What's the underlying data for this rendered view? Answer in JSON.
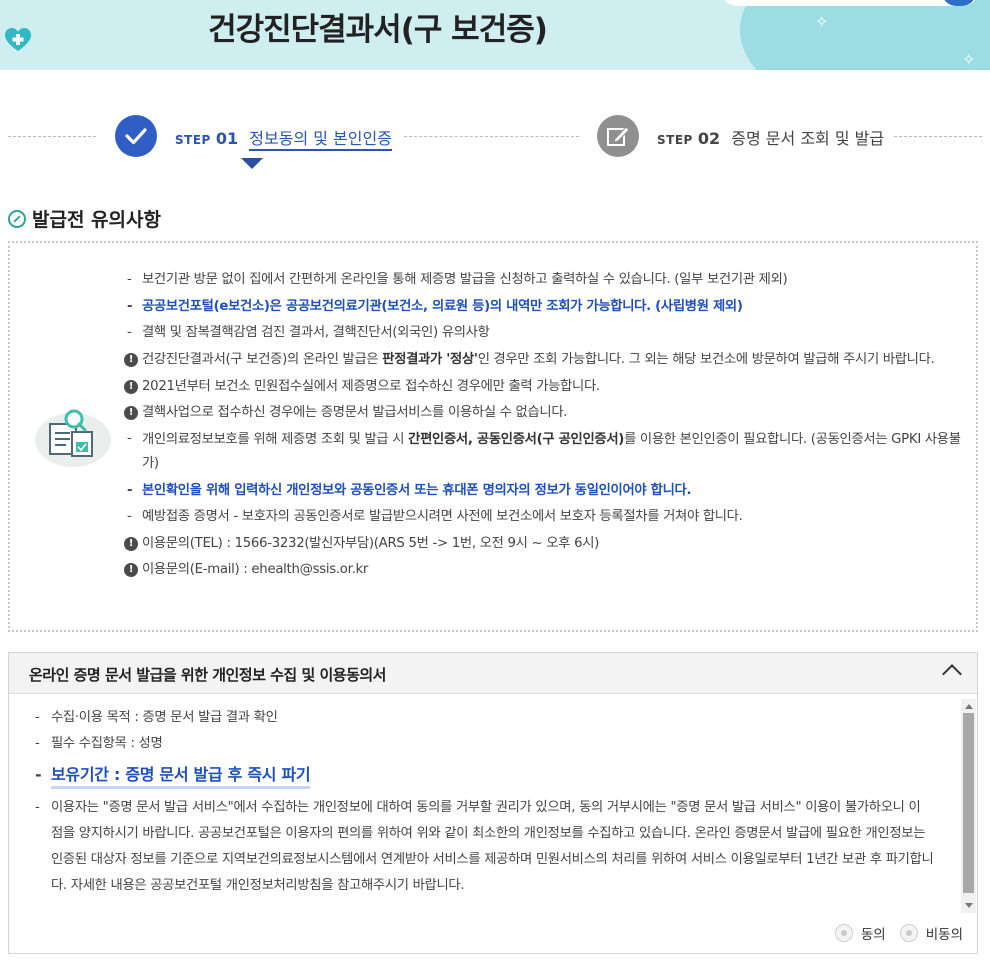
{
  "header": {
    "title": "건강진단결과서(구 보건증)"
  },
  "steps": [
    {
      "word": "STEP",
      "number": "01",
      "label": "정보동의 및 본인인증"
    },
    {
      "word": "STEP",
      "number": "02",
      "label": "증명 문서 조회 및 발급"
    }
  ],
  "notice": {
    "title": "발급전 유의사항",
    "items": {
      "i0": "보건기관 방문 없이 집에서 간편하게 온라인을 통해 제증명 발급을 신청하고 출력하실 수 있습니다. (일부 보건기관 제외)",
      "i1": "공공보건포털(e보건소)은 공공보건의료기관(보건소, 의료원 등)의 내역만 조회가 가능합니다. (사립병원 제외)",
      "i2": "결핵 및 잠복결핵감염 검진 결과서, 결핵진단서(외국인) 유의사항",
      "i3a": "건강진단결과서(구 보건증)의 온라인 발급은 ",
      "i3b": "판정결과가 '정상'",
      "i3c": "인 경우만 조회 가능합니다. 그 외는 해당 보건소에 방문하여 발급해 주시기 바랍니다.",
      "i4": "2021년부터 보건소 민원접수실에서 제증명으로 접수하신 경우에만 출력 가능합니다.",
      "i5": "결핵사업으로 접수하신 경우에는 증명문서 발급서비스를 이용하실 수 없습니다.",
      "i6a": "개인의료정보보호를 위해 제증명 조회 및 발급 시 ",
      "i6b": "간편인증서, 공동인증서(구 공인인증서)",
      "i6c": "를 이용한 본인인증이 필요합니다. (공동인증서는 GPKI 사용불가)",
      "i7": "본인확인을 위해 입력하신 개인정보와 공동인증서 또는 휴대폰 명의자의 정보가 동일인이어야 합니다.",
      "i8": "예방접종 증명서 - 보호자의 공동인증서로 발급받으시려면 사전에 보건소에서 보호자 등록절차를 거쳐야 합니다.",
      "i9": "이용문의(TEL) : 1566-3232(발신자부담)(ARS 5번 -> 1번, 오전 9시 ~ 오후 6시)",
      "i10": "이용문의(E-mail) : ehealth@ssis.or.kr"
    }
  },
  "agreement": {
    "title": "온라인 증명 문서 발급을 위한 개인정보 수집 및 이용동의서",
    "items": {
      "purpose": "수집·이용 목적 : 증명 문서 발급 결과 확인",
      "required": "필수 수집항목 : 성명",
      "retention": "보유기간 : 증명 문서 발급 후 즉시 파기",
      "detail": "이용자는 \"증명 문서 발급 서비스\"에서 수집하는 개인정보에 대하여 동의를 거부할 권리가 있으며, 동의 거부시에는 \"증명 문서 발급 서비스\" 이용이 불가하오니 이 점을 양지하시기 바랍니다. 공공보건포털은 이용자의 편의를 위하여 위와 같이 최소한의 개인정보를 수집하고 있습니다. 온라인 증명문서 발급에 필요한 개인정보는 인증된 대상자 정보를 기준으로 지역보건의료정보시스템에서 연계받아 서비스를 제공하며 민원서비스의 처리를 위하여 서비스 이용일로부터 1년간 보관 후 파기합니다. 자세한 내용은 공공보건포털 개인정보처리방침을 참고해주시기 바랍니다."
    },
    "agree_label": "동의",
    "disagree_label": "비동의"
  },
  "colors": {
    "accent": "#2a55b0",
    "notice_blue": "#1f4fbf",
    "banner_bg": "#cfeef0",
    "inactive_step": "#8a8a8a"
  },
  "icons": [
    "heart-cross-icon",
    "checkmark-icon",
    "pencil-edit-icon",
    "pen-circle-icon",
    "document-magnifier-icon",
    "exclamation-icon",
    "chevron-up-icon",
    "sparkle-icon"
  ]
}
